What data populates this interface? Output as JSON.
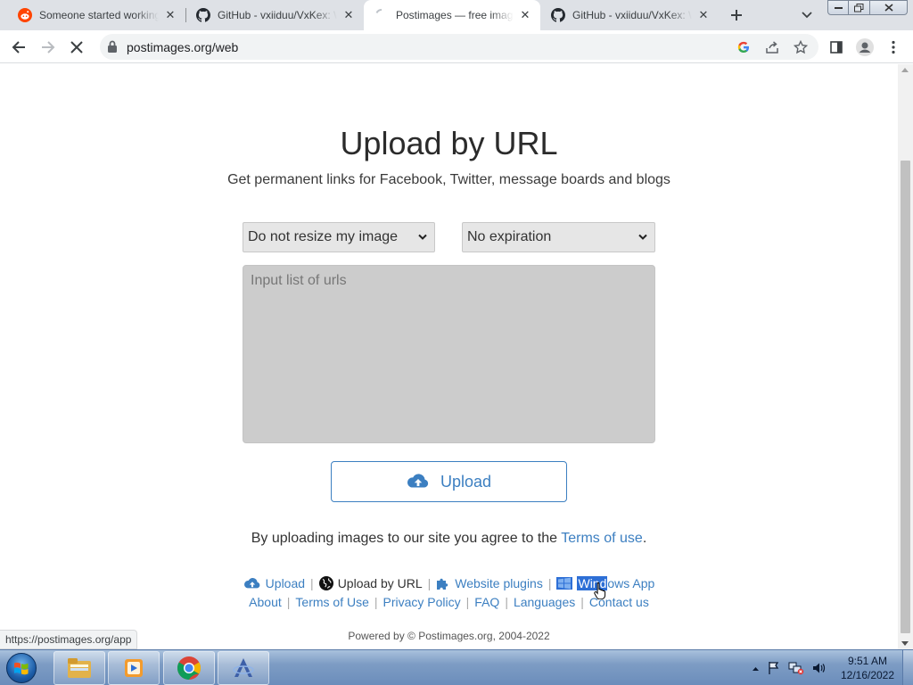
{
  "browser": {
    "tabs": [
      {
        "title": "Someone started working on a...",
        "icon": "reddit-icon"
      },
      {
        "title": "GitHub - vxiiduu/VxKex: Wind...",
        "icon": "github-icon"
      },
      {
        "title": "Postimages — free image hosting",
        "icon": "loading-spinner-icon",
        "active": true
      },
      {
        "title": "GitHub - vxiiduu/VxKex: Wind...",
        "icon": "github-icon"
      }
    ],
    "address": "postimages.org/web",
    "status_url": "https://postimages.org/app"
  },
  "page": {
    "heading": "Upload by URL",
    "subheading": "Get permanent links for Facebook, Twitter, message boards and blogs",
    "resize_select": "Do not resize my image",
    "expiration_select": "No expiration",
    "urls_placeholder": "Input list of urls",
    "upload_label": "Upload",
    "agree_text": "By uploading images to our site you agree to the",
    "terms_link": "Terms of use",
    "agree_end": ".",
    "footer_row1": {
      "upload": "Upload",
      "upload_by_url": "Upload by URL",
      "website_plugins": "Website plugins",
      "windows_app_highlight": "Wind",
      "windows_app_rest": "ows App"
    },
    "footer_row2": {
      "about": "About",
      "terms": "Terms of Use",
      "privacy": "Privacy Policy",
      "faq": "FAQ",
      "languages": "Languages",
      "contact": "Contact us"
    },
    "separator": "|",
    "powered_by": "Powered by © Postimages.org, 2004-2022"
  },
  "taskbar": {
    "time": "9:51 AM",
    "date": "12/16/2022"
  },
  "colors": {
    "link": "#3c7fc1",
    "tabstrip": "#dee1e6",
    "textarea": "#cccccc"
  }
}
